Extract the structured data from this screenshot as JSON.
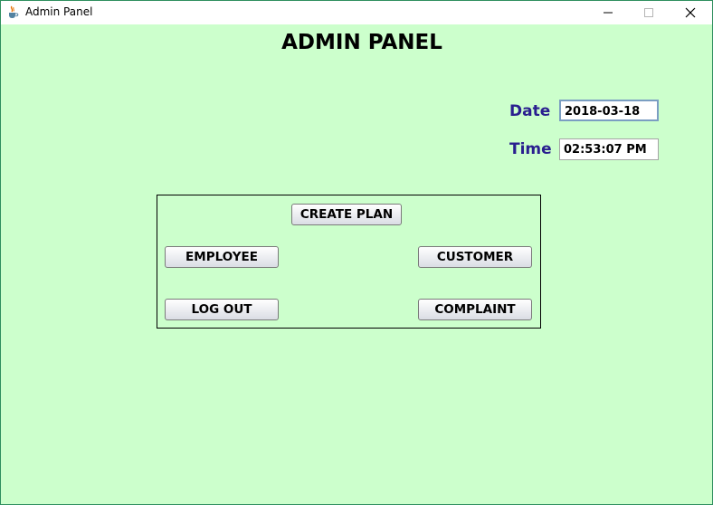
{
  "window": {
    "title": "Admin Panel",
    "icon": "java-cup-icon",
    "controls": [
      "minimize-icon",
      "maximize-icon",
      "close-icon"
    ]
  },
  "heading": "ADMIN PANEL",
  "date": {
    "label": "Date",
    "value": "2018-03-18"
  },
  "time": {
    "label": "Time",
    "value": "02:53:07 PM"
  },
  "buttons": {
    "create_plan": "CREATE PLAN",
    "employee": "EMPLOYEE",
    "customer": "CUSTOMER",
    "log_out": "LOG OUT",
    "complaint": "COMPLAINT"
  },
  "colors": {
    "background": "#ccffcc",
    "label": "#2a1f8f",
    "frame_border": "#2f8f5f"
  }
}
